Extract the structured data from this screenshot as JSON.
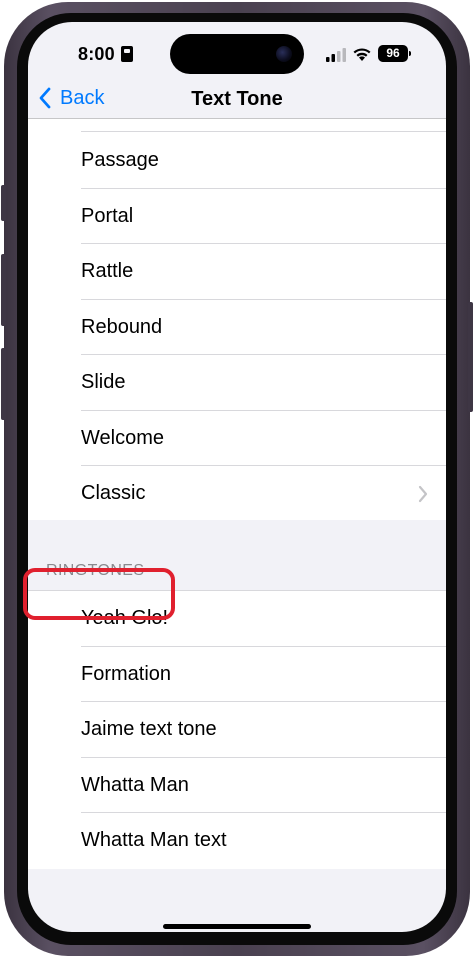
{
  "status_bar": {
    "time": "8:00",
    "battery": "96",
    "icons": [
      "id-card-icon",
      "cellular-signal-icon",
      "wifi-icon",
      "battery-icon"
    ]
  },
  "nav": {
    "back_label": "Back",
    "title": "Text Tone"
  },
  "alert_tones": [
    {
      "label": "Passage"
    },
    {
      "label": "Portal"
    },
    {
      "label": "Rattle"
    },
    {
      "label": "Rebound"
    },
    {
      "label": "Slide"
    },
    {
      "label": "Welcome"
    },
    {
      "label": "Classic"
    }
  ],
  "ringtones": {
    "header": "RINGTONES",
    "items": [
      {
        "label": "Yeah Glo!"
      },
      {
        "label": "Formation"
      },
      {
        "label": "Jaime text tone"
      },
      {
        "label": "Whatta Man"
      },
      {
        "label": "Whatta Man text"
      }
    ]
  },
  "colors": {
    "accent": "#007aff",
    "highlight": "#e0202e",
    "background": "#f2f2f7"
  }
}
